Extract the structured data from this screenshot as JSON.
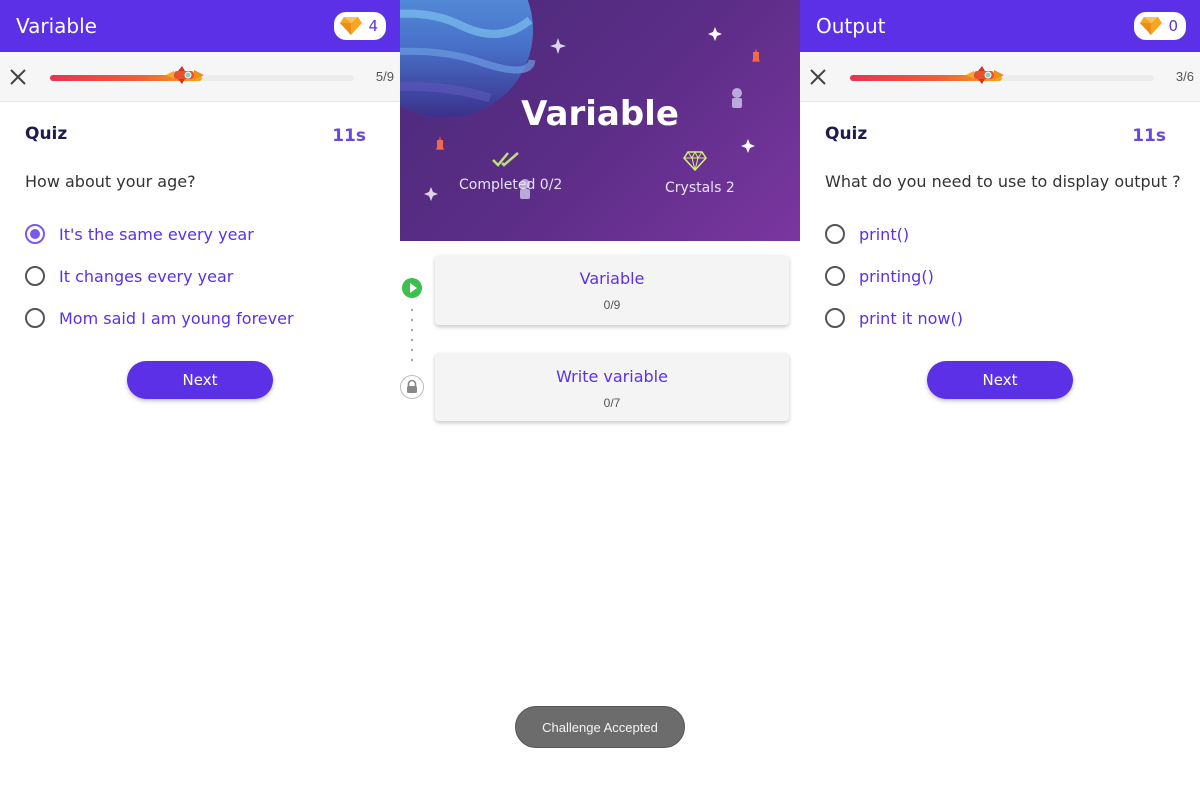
{
  "left": {
    "title": "Variable",
    "gem_count": "4",
    "progress_text": "5/9",
    "progress": 0.5,
    "quiz_label": "Quiz",
    "timer": "11s",
    "question": "How about your age?",
    "options": [
      {
        "label": "It's the same every year",
        "selected": true
      },
      {
        "label": "It changes every year",
        "selected": false
      },
      {
        "label": "Mom said I am young forever",
        "selected": false
      }
    ],
    "next_label": "Next"
  },
  "middle": {
    "banner_title": "Variable",
    "completed": "Completed 0/2",
    "crystals": "Crystals 2",
    "lessons": [
      {
        "title": "Variable",
        "count": "0/9",
        "status": "playable"
      },
      {
        "title": "Write variable",
        "count": "0/7",
        "status": "locked"
      }
    ],
    "toast": "Challenge Accepted"
  },
  "right": {
    "title": "Output",
    "gem_count": "0",
    "progress_text": "3/6",
    "progress": 0.5,
    "quiz_label": "Quiz",
    "timer": "11s",
    "question": "What do you need to use to display output ?",
    "options": [
      {
        "label": "print()",
        "selected": false
      },
      {
        "label": "printing()",
        "selected": false
      },
      {
        "label": "print it now()",
        "selected": false
      }
    ],
    "next_label": "Next"
  },
  "colors": {
    "accent": "#5b30e6",
    "header": "#5b30e6",
    "play": "#3bbf4d",
    "gem": "#f5a623"
  },
  "icons": [
    "close-icon",
    "gem-icon",
    "rocket-icon",
    "play-icon",
    "lock-icon",
    "double-check-icon",
    "crystal-icon"
  ]
}
